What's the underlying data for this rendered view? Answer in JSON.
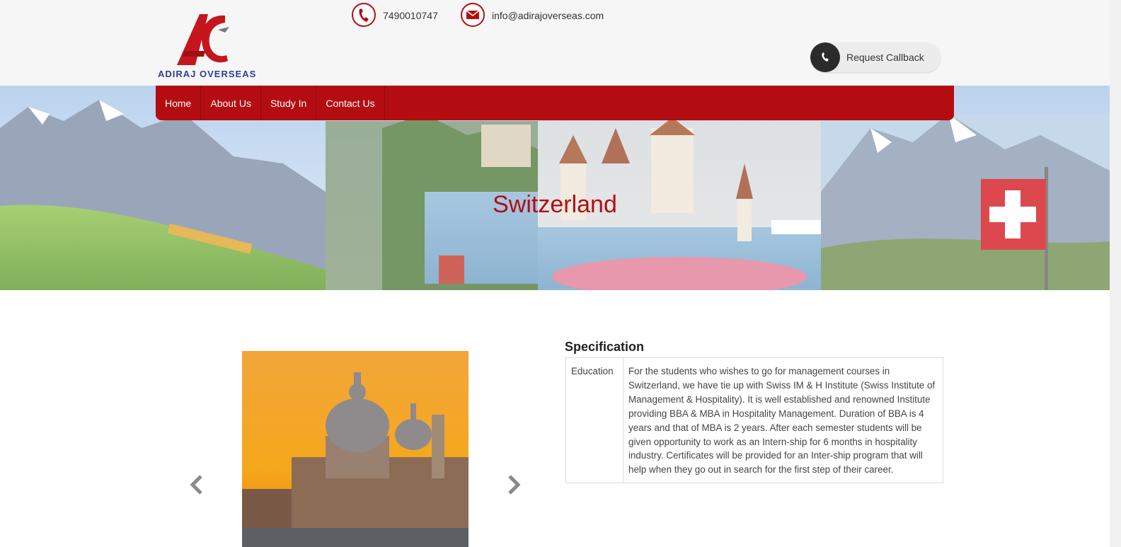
{
  "header": {
    "logo_text": "ADIRAJ OVERSEAS",
    "logo_icon": "ao-logo-icon",
    "phone": "7490010747",
    "phone_icon": "phone-icon",
    "email": "info@adirajoverseas.com",
    "email_icon": "envelope-icon",
    "callback_label": "Request Callback",
    "callback_icon": "phone-icon"
  },
  "nav": {
    "items": [
      {
        "label": "Home"
      },
      {
        "label": "About Us"
      },
      {
        "label": "Study In"
      },
      {
        "label": "Contact Us"
      }
    ]
  },
  "banner": {
    "title": "Switzerland"
  },
  "slider": {
    "prev_icon": "chevron-left-icon",
    "next_icon": "chevron-right-icon"
  },
  "specification": {
    "title": "Specification",
    "rows": [
      {
        "key": "Education",
        "value": "For the students who wishes to go for management courses in Switzerland, we have tie up with Swiss IM & H Institute (Swiss Institute of Management & Hospitality). It is well established and renowned Institute providing BBA & MBA in Hospitality Management. Duration of BBA is 4 years and that of MBA is 2 years. After each semester students will be given opportunity to work as an Intern-ship for 6 months in hospitality industry. Certificates will be provided for an Inter-ship program that will help when they go out in search for the first step of their career."
      }
    ]
  },
  "colors": {
    "brand_red": "#b30d12",
    "logo_blue": "#2e3f8f",
    "header_bg": "#f6f6f6"
  }
}
